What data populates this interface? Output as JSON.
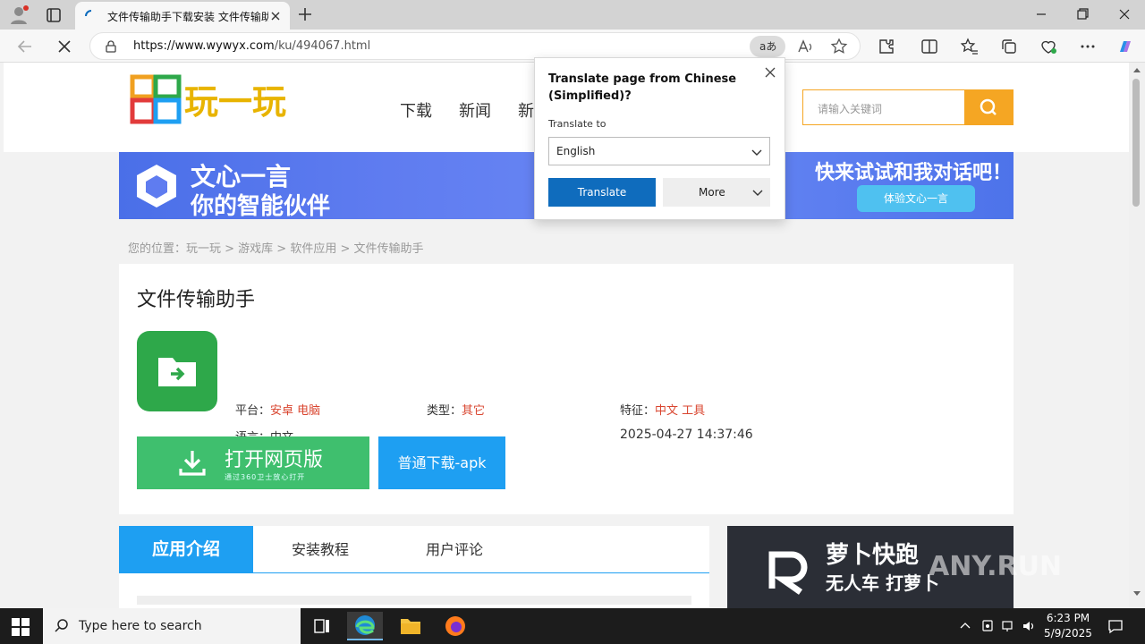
{
  "browser": {
    "tab_title": "文件传输助手下载安装 文件传输助手",
    "url_host": "https://www.wywyx.com",
    "url_path": "/ku/494067.html",
    "translate_icon_label": "aあ"
  },
  "translate_popup": {
    "heading": "Translate page from Chinese (Simplified)?",
    "translate_to_label": "Translate to",
    "language_value": "English",
    "translate_button": "Translate",
    "more_button": "More"
  },
  "site": {
    "logo_text": "玩一玩",
    "nav": [
      "下载",
      "新闻",
      "新"
    ],
    "search_placeholder": "请输入关键词"
  },
  "banner": {
    "title1": "文心一言",
    "title2": "你的智能伙伴",
    "slogan": "快来试试和我对话吧！",
    "cta": "体验文心一言"
  },
  "breadcrumb": "您的位置：玩一玩 > 游戏库 > 软件应用 > 文件传输助手",
  "app": {
    "name": "文件传输助手",
    "platform_label": "平台：",
    "platform_value": "安卓 电脑",
    "type_label": "类型：",
    "type_value": "其它",
    "feature_label": "特征：",
    "feature_value": "中文 工具",
    "language_label": "语言：",
    "language_value": "中文",
    "date": "2025-04-27 14:37:46",
    "open_web_label": "打开网页版",
    "open_web_sub": "通过360卫士放心打开",
    "download_apk_label": "普通下载-apk"
  },
  "content_tabs": [
    "应用介绍",
    "安装教程",
    "用户评论"
  ],
  "side_ad": {
    "line1": "萝卜快跑",
    "line2": "无人车 打萝卜"
  },
  "watermark": "ANY.RUN",
  "taskbar": {
    "search_label": "Type here to search",
    "time": "6:23 PM",
    "date": "5/9/2025"
  },
  "colors": {
    "accent": "#1e9ff2",
    "search_orange": "#f5a623",
    "green": "#3fbf6e",
    "edge_blue": "#0f6cbd"
  }
}
